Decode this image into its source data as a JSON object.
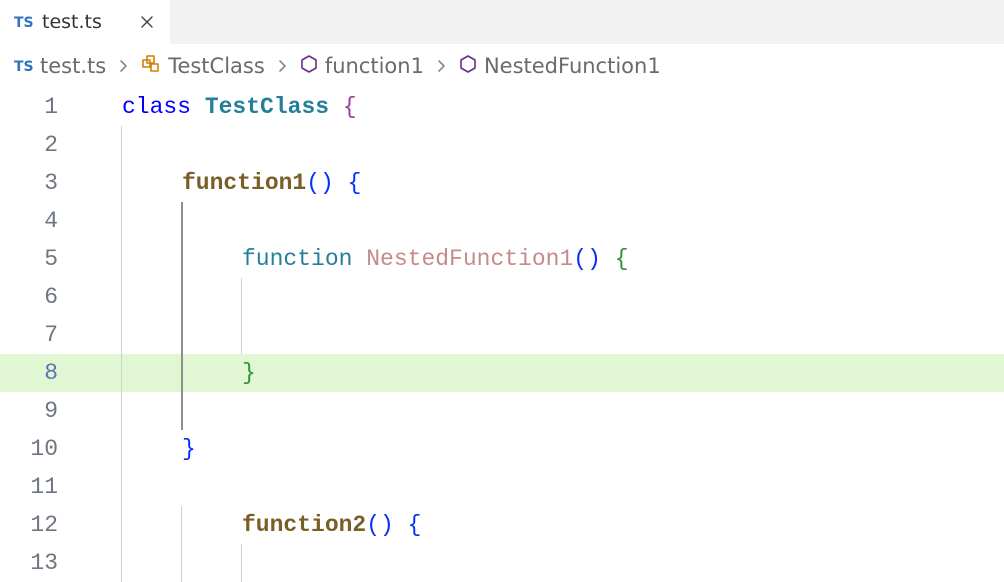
{
  "tab": {
    "filename": "test.ts",
    "icon": "ts-icon"
  },
  "breadcrumb": {
    "file": "test.ts",
    "segments": [
      {
        "icon": "class-icon",
        "label": "TestClass"
      },
      {
        "icon": "method-icon",
        "label": "function1"
      },
      {
        "icon": "method-icon",
        "label": "NestedFunction1"
      }
    ]
  },
  "code": {
    "l1": {
      "kw": "class",
      "type": "TestClass",
      "brace": "{"
    },
    "l3": {
      "method": "function1",
      "parens": "()",
      "brace": "{"
    },
    "l5": {
      "kw": "function",
      "name": "NestedFunction1",
      "parens": "()",
      "brace": "{"
    },
    "l8": {
      "brace": "}"
    },
    "l10": {
      "brace": "}"
    },
    "l12": {
      "method": "function2",
      "parens": "()",
      "brace": "{"
    }
  },
  "lineNumbers": {
    "l1": "1",
    "l2": "2",
    "l3": "3",
    "l4": "4",
    "l5": "5",
    "l6": "6",
    "l7": "7",
    "l8": "8",
    "l9": "9",
    "l10": "10",
    "l11": "11",
    "l12": "12",
    "l13": "13"
  },
  "colors": {
    "highlight": "#e1f6d2",
    "keyword": "#0000ff",
    "type": "#267f99",
    "method": "#795e26"
  }
}
